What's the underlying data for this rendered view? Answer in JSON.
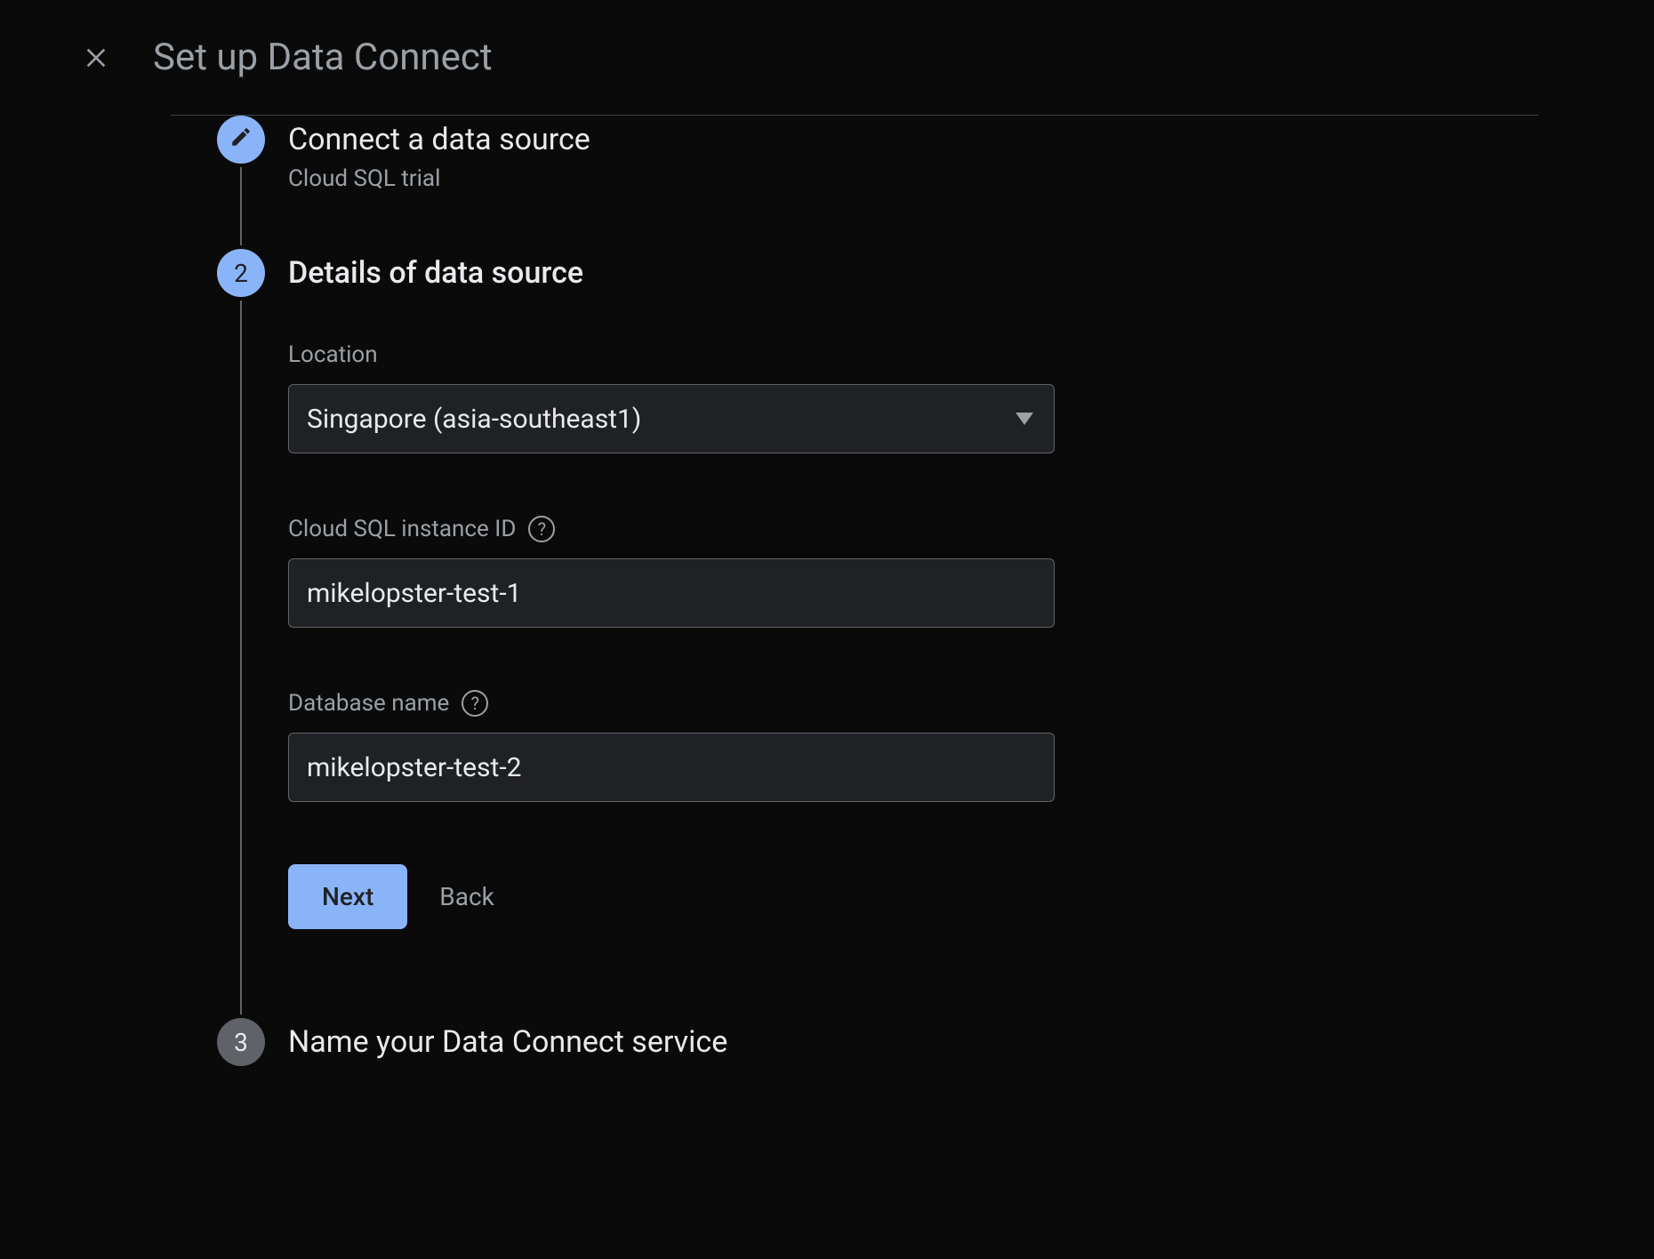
{
  "header": {
    "title": "Set up Data Connect"
  },
  "steps": {
    "s1": {
      "title": "Connect a data source",
      "subtitle": "Cloud SQL trial"
    },
    "s2": {
      "number": "2",
      "title": "Details of data source",
      "location_label": "Location",
      "location_value": "Singapore (asia-southeast1)",
      "instance_label": "Cloud SQL instance ID",
      "instance_value": "mikelopster-test-1",
      "dbname_label": "Database name",
      "dbname_value": "mikelopster-test-2",
      "next_label": "Next",
      "back_label": "Back"
    },
    "s3": {
      "number": "3",
      "title": "Name your Data Connect service"
    }
  }
}
